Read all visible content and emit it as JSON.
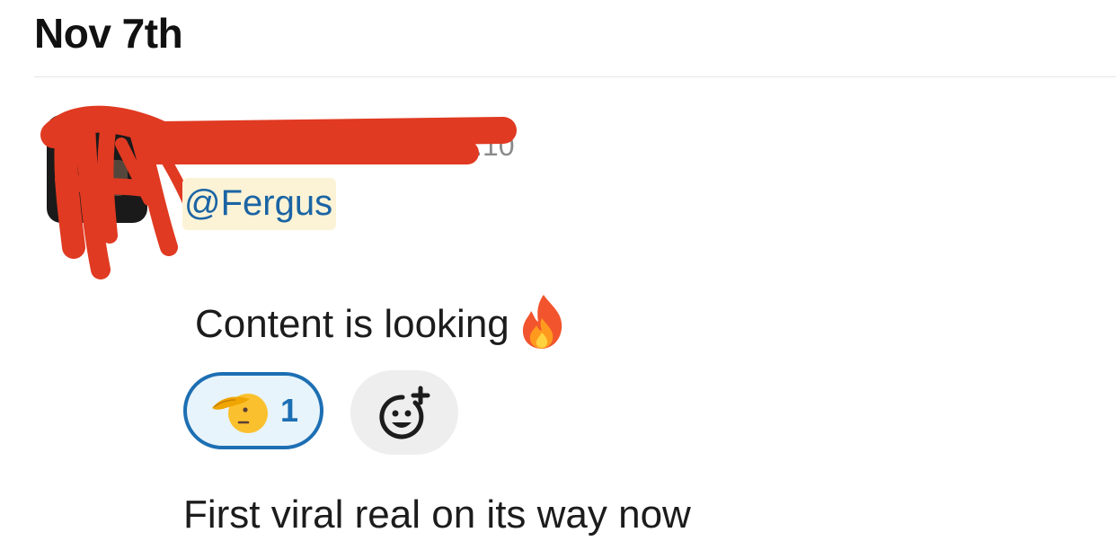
{
  "day_divider": {
    "date": "Nov 7th"
  },
  "message": {
    "timestamp": ".10",
    "mention": "@Fergus",
    "lines": [
      "Content is looking",
      "First viral real on its way now"
    ],
    "inline_emoji": "fire-icon"
  },
  "reactions": [
    {
      "emoji": "saluting-face-icon",
      "count": "1",
      "selected": true
    }
  ],
  "add_reaction": {
    "icon": "add-reaction-icon"
  },
  "colors": {
    "mention_text": "#1a64a4",
    "mention_bg": "#fcf3d6",
    "reaction_border": "#1d6fb3",
    "reaction_bg": "#e8f4fb",
    "redaction": "#e03a22"
  }
}
